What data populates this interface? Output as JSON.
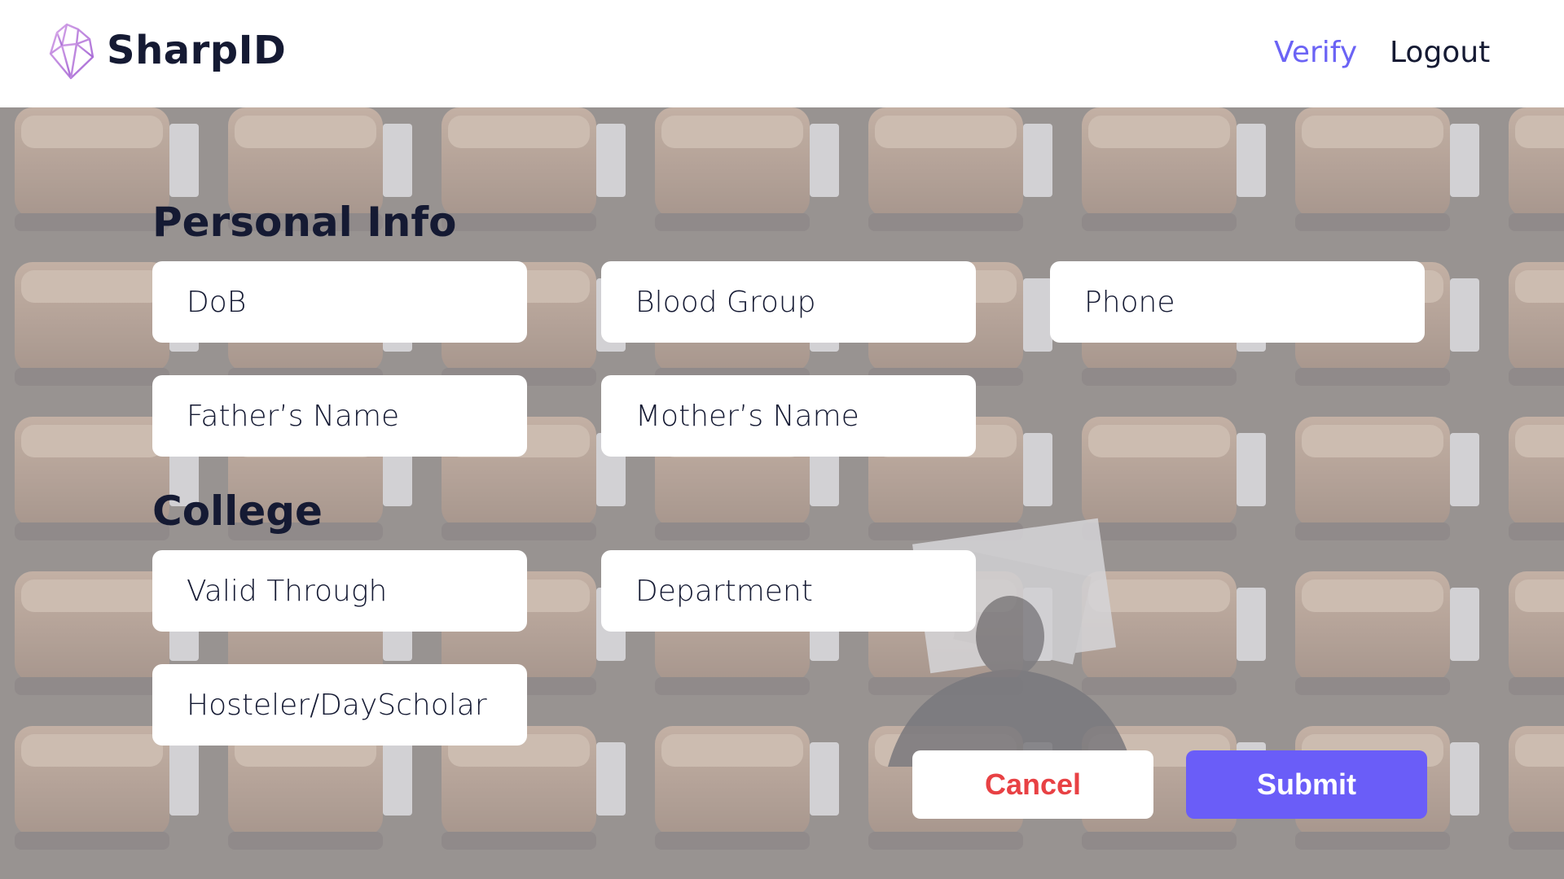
{
  "app": {
    "brand": "SharpID",
    "nav": {
      "verify": "Verify",
      "logout": "Logout"
    },
    "colors": {
      "accent": "#6a5df8",
      "nav_active": "#6b63f5",
      "cancel_text": "#e84144",
      "text_dark": "#151a33"
    },
    "icons": {
      "logo": "crystal-logo-icon"
    }
  },
  "personal_info": {
    "title": "Personal Info",
    "fields": {
      "dob": "DoB",
      "blood_group": "Blood Group",
      "phone": "Phone",
      "fathers_name": "Father’s Name",
      "mothers_name": "Mother’s Name"
    }
  },
  "college": {
    "title": "College",
    "fields": {
      "valid_through": "Valid Through",
      "department": "Department",
      "hosteler": "Hosteler/DayScholar"
    }
  },
  "actions": {
    "cancel": "Cancel",
    "submit": "Submit"
  }
}
